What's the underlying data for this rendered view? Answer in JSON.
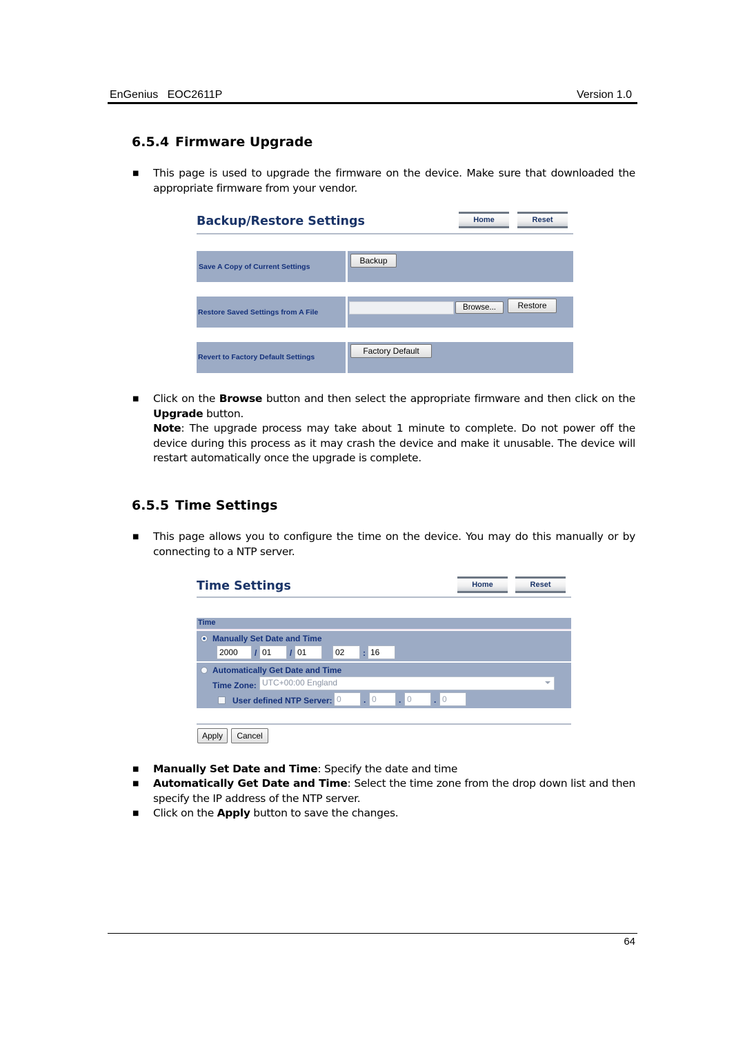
{
  "header": {
    "product": "EnGenius   EOC2611P",
    "version": "Version 1.0"
  },
  "footer": {
    "page_number": "64"
  },
  "section_firmware": {
    "number": "6.5.4",
    "title": "Firmware Upgrade",
    "intro": "This page is used to upgrade the firmware on the device. Make sure that downloaded the appropriate firmware from your vendor.",
    "instructions": {
      "p1_a": "Click on the ",
      "p1_b1": "Browse",
      "p1_c": " button and then select the appropriate firmware and then click on the ",
      "p1_b2": "Upgrade",
      "p1_d": " button.",
      "note_label": "Note",
      "note_text": ": The upgrade process may take about 1 minute to complete. Do not power off the device during this process as it may crash the device and make it unusable. The device will restart automatically once the upgrade is complete."
    }
  },
  "backup_ui": {
    "title": "Backup/Restore Settings",
    "home_label": "Home",
    "reset_label": "Reset",
    "rows": [
      {
        "label": "Save A Copy of Current Settings",
        "button": "Backup"
      },
      {
        "label": "Restore Saved Settings from A File",
        "browse": "Browse...",
        "button": "Restore",
        "file_value": ""
      },
      {
        "label": "Revert to Factory Default Settings",
        "button": "Factory Default"
      }
    ]
  },
  "section_time": {
    "number": "6.5.5",
    "title": "Time Settings",
    "intro": "This page allows you to configure the time on the device. You may do this manually or by connecting to a NTP server.",
    "bullets": [
      {
        "bold": "Manually Set Date and Time",
        "text": ": Specify the date and time"
      },
      {
        "bold": "Automatically Get Date and Time",
        "text": ": Select the time zone from the drop down list and then specify the IP address of the NTP server."
      },
      {
        "pre": "Click on the ",
        "bold": "Apply",
        "text": " button to save the changes."
      }
    ]
  },
  "time_ui": {
    "title": "Time Settings",
    "home_label": "Home",
    "reset_label": "Reset",
    "section_header": "Time",
    "manual": {
      "label": "Manually Set Date and Time",
      "selected": true,
      "year": "2000",
      "month": "01",
      "day": "01",
      "hour": "02",
      "minute": "16",
      "date_sep": "/",
      "time_sep": ":"
    },
    "auto": {
      "label": "Automatically Get Date and Time",
      "selected": false,
      "timezone_label": "Time Zone:",
      "timezone_value": "UTC+00:00 England",
      "ntp_label": "User defined NTP Server:",
      "ntp_checked": false,
      "ntp_octets": [
        "0",
        "0",
        "0",
        "0"
      ],
      "ip_sep": "."
    },
    "apply_label": "Apply",
    "cancel_label": "Cancel"
  }
}
